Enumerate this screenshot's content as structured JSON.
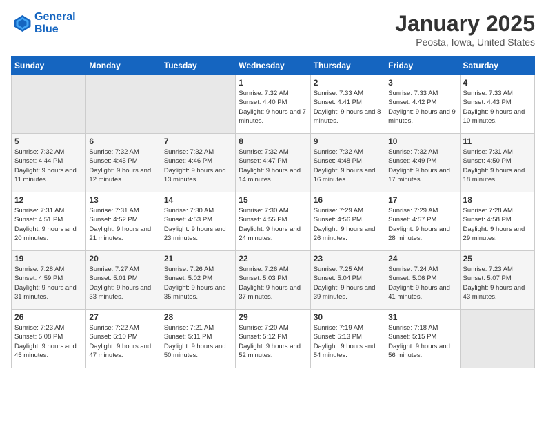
{
  "header": {
    "logo_line1": "General",
    "logo_line2": "Blue",
    "title": "January 2025",
    "subtitle": "Peosta, Iowa, United States"
  },
  "weekdays": [
    "Sunday",
    "Monday",
    "Tuesday",
    "Wednesday",
    "Thursday",
    "Friday",
    "Saturday"
  ],
  "weeks": [
    [
      {
        "day": "",
        "info": ""
      },
      {
        "day": "",
        "info": ""
      },
      {
        "day": "",
        "info": ""
      },
      {
        "day": "1",
        "info": "Sunrise: 7:32 AM\nSunset: 4:40 PM\nDaylight: 9 hours and 7 minutes."
      },
      {
        "day": "2",
        "info": "Sunrise: 7:33 AM\nSunset: 4:41 PM\nDaylight: 9 hours and 8 minutes."
      },
      {
        "day": "3",
        "info": "Sunrise: 7:33 AM\nSunset: 4:42 PM\nDaylight: 9 hours and 9 minutes."
      },
      {
        "day": "4",
        "info": "Sunrise: 7:33 AM\nSunset: 4:43 PM\nDaylight: 9 hours and 10 minutes."
      }
    ],
    [
      {
        "day": "5",
        "info": "Sunrise: 7:32 AM\nSunset: 4:44 PM\nDaylight: 9 hours and 11 minutes."
      },
      {
        "day": "6",
        "info": "Sunrise: 7:32 AM\nSunset: 4:45 PM\nDaylight: 9 hours and 12 minutes."
      },
      {
        "day": "7",
        "info": "Sunrise: 7:32 AM\nSunset: 4:46 PM\nDaylight: 9 hours and 13 minutes."
      },
      {
        "day": "8",
        "info": "Sunrise: 7:32 AM\nSunset: 4:47 PM\nDaylight: 9 hours and 14 minutes."
      },
      {
        "day": "9",
        "info": "Sunrise: 7:32 AM\nSunset: 4:48 PM\nDaylight: 9 hours and 16 minutes."
      },
      {
        "day": "10",
        "info": "Sunrise: 7:32 AM\nSunset: 4:49 PM\nDaylight: 9 hours and 17 minutes."
      },
      {
        "day": "11",
        "info": "Sunrise: 7:31 AM\nSunset: 4:50 PM\nDaylight: 9 hours and 18 minutes."
      }
    ],
    [
      {
        "day": "12",
        "info": "Sunrise: 7:31 AM\nSunset: 4:51 PM\nDaylight: 9 hours and 20 minutes."
      },
      {
        "day": "13",
        "info": "Sunrise: 7:31 AM\nSunset: 4:52 PM\nDaylight: 9 hours and 21 minutes."
      },
      {
        "day": "14",
        "info": "Sunrise: 7:30 AM\nSunset: 4:53 PM\nDaylight: 9 hours and 23 minutes."
      },
      {
        "day": "15",
        "info": "Sunrise: 7:30 AM\nSunset: 4:55 PM\nDaylight: 9 hours and 24 minutes."
      },
      {
        "day": "16",
        "info": "Sunrise: 7:29 AM\nSunset: 4:56 PM\nDaylight: 9 hours and 26 minutes."
      },
      {
        "day": "17",
        "info": "Sunrise: 7:29 AM\nSunset: 4:57 PM\nDaylight: 9 hours and 28 minutes."
      },
      {
        "day": "18",
        "info": "Sunrise: 7:28 AM\nSunset: 4:58 PM\nDaylight: 9 hours and 29 minutes."
      }
    ],
    [
      {
        "day": "19",
        "info": "Sunrise: 7:28 AM\nSunset: 4:59 PM\nDaylight: 9 hours and 31 minutes."
      },
      {
        "day": "20",
        "info": "Sunrise: 7:27 AM\nSunset: 5:01 PM\nDaylight: 9 hours and 33 minutes."
      },
      {
        "day": "21",
        "info": "Sunrise: 7:26 AM\nSunset: 5:02 PM\nDaylight: 9 hours and 35 minutes."
      },
      {
        "day": "22",
        "info": "Sunrise: 7:26 AM\nSunset: 5:03 PM\nDaylight: 9 hours and 37 minutes."
      },
      {
        "day": "23",
        "info": "Sunrise: 7:25 AM\nSunset: 5:04 PM\nDaylight: 9 hours and 39 minutes."
      },
      {
        "day": "24",
        "info": "Sunrise: 7:24 AM\nSunset: 5:06 PM\nDaylight: 9 hours and 41 minutes."
      },
      {
        "day": "25",
        "info": "Sunrise: 7:23 AM\nSunset: 5:07 PM\nDaylight: 9 hours and 43 minutes."
      }
    ],
    [
      {
        "day": "26",
        "info": "Sunrise: 7:23 AM\nSunset: 5:08 PM\nDaylight: 9 hours and 45 minutes."
      },
      {
        "day": "27",
        "info": "Sunrise: 7:22 AM\nSunset: 5:10 PM\nDaylight: 9 hours and 47 minutes."
      },
      {
        "day": "28",
        "info": "Sunrise: 7:21 AM\nSunset: 5:11 PM\nDaylight: 9 hours and 50 minutes."
      },
      {
        "day": "29",
        "info": "Sunrise: 7:20 AM\nSunset: 5:12 PM\nDaylight: 9 hours and 52 minutes."
      },
      {
        "day": "30",
        "info": "Sunrise: 7:19 AM\nSunset: 5:13 PM\nDaylight: 9 hours and 54 minutes."
      },
      {
        "day": "31",
        "info": "Sunrise: 7:18 AM\nSunset: 5:15 PM\nDaylight: 9 hours and 56 minutes."
      },
      {
        "day": "",
        "info": ""
      }
    ]
  ]
}
